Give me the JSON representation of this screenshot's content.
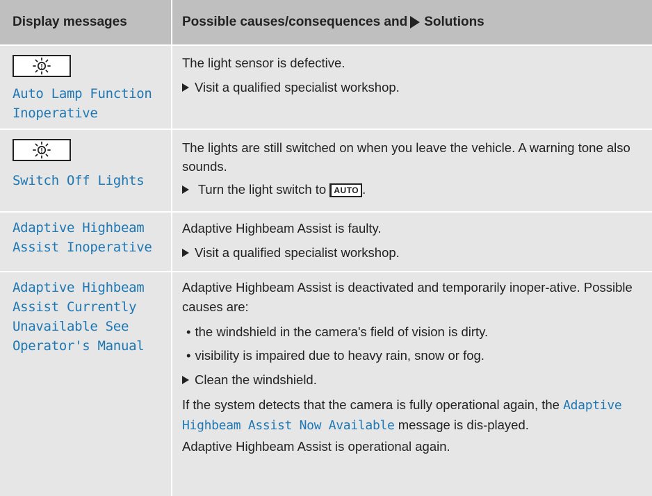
{
  "header": {
    "left": "Display messages",
    "right_prefix": "Possible causes/consequences and",
    "right_suffix": "Solutions"
  },
  "rows": [
    {
      "icon": "exterior-lamp-icon",
      "message": "Auto Lamp Function Inoperative",
      "cause": "The light sensor is defective.",
      "action": "Visit a qualified specialist workshop."
    },
    {
      "icon": "exterior-lamp-icon",
      "message": "Switch Off Lights",
      "cause": "The lights are still switched on when you leave the vehicle. A warning tone also sounds.",
      "action_prefix": "Turn the light switch to",
      "action_key": "AUTO",
      "action_suffix": "."
    },
    {
      "message": "Adaptive Highbeam Assist Inoperative",
      "cause": "Adaptive Highbeam Assist is faulty.",
      "action": "Visit a qualified specialist workshop."
    },
    {
      "message": "Adaptive Highbeam Assist Currently Unavailable See Operator's Manual",
      "cause": "Adaptive Highbeam Assist is deactivated and temporarily inoper-ative. Possible causes are:",
      "bullets": [
        "the windshield in the camera's field of vision is dirty.",
        "visibility is impaired due to heavy rain, snow or fog."
      ],
      "action": "Clean the windshield.",
      "note_prefix": "If the system detects that the camera is fully operational again, the",
      "note_message": "Adaptive Highbeam Assist Now Available",
      "note_suffix": "message is dis-played.",
      "final": "Adaptive Highbeam Assist is operational again."
    }
  ],
  "colors": {
    "header_bg": "#bfbfbf",
    "row_bg": "#e6e6e6",
    "message_text": "#1e78b4"
  }
}
